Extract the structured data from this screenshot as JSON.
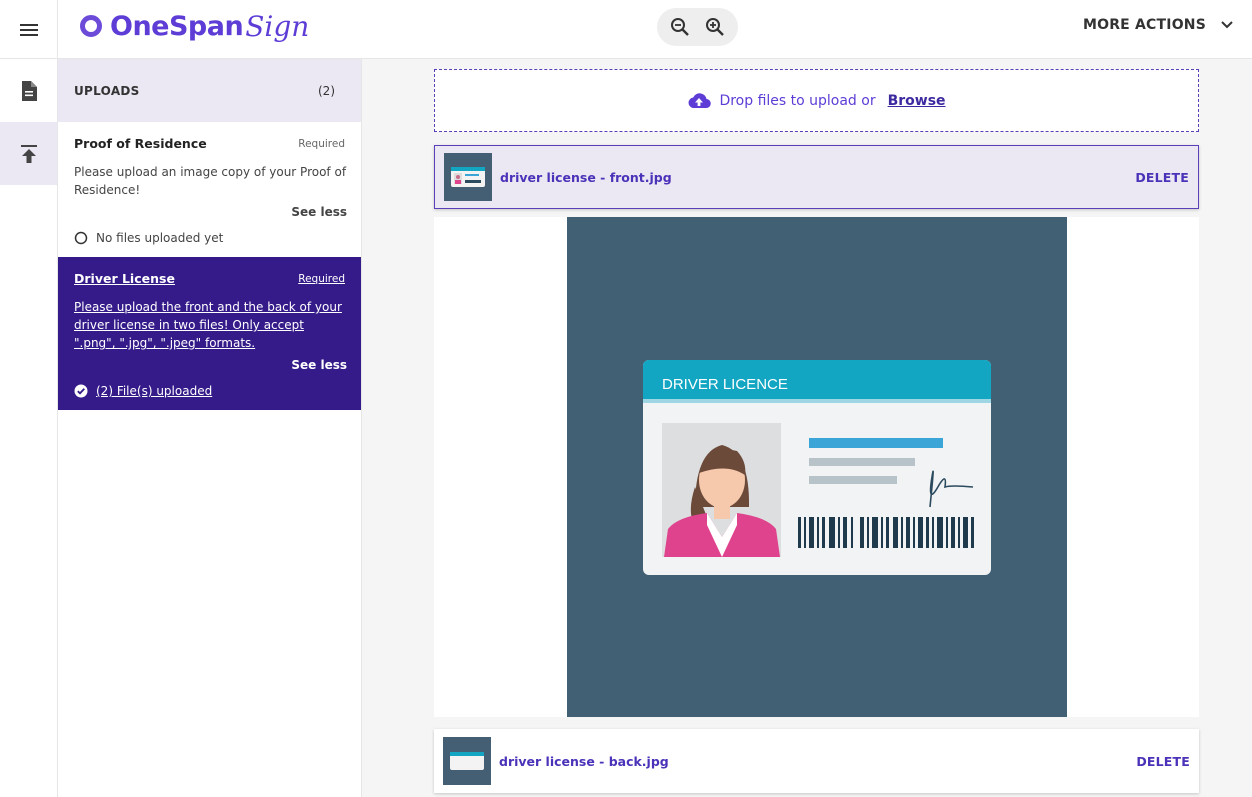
{
  "header": {
    "brand": "OneSpan",
    "brand_script": "Sign",
    "more_actions_label": "MORE ACTIONS"
  },
  "uploads": {
    "title": "UPLOADS",
    "count": "(2)",
    "items": [
      {
        "title": "Proof of Residence",
        "required": "Required",
        "description": "Please upload an image copy of your Proof of Residence!",
        "see_less": "See less",
        "status": "No files uploaded yet"
      },
      {
        "title": "Driver License",
        "required": "Required",
        "description": "Please upload the front and the back of your driver license in two files! Only accept \".png\", \".jpg\", \".jpeg\" formats.",
        "see_less": "See less",
        "status": "(2) File(s) uploaded"
      }
    ]
  },
  "dropzone": {
    "text": "Drop files to upload or",
    "browse": "Browse"
  },
  "files": [
    {
      "name": "driver license - front.jpg",
      "delete": "DELETE"
    },
    {
      "name": "driver license - back.jpg",
      "delete": "DELETE"
    }
  ],
  "preview": {
    "card_title": "DRIVER LICENCE"
  },
  "colors": {
    "accent": "#5d3dd6",
    "selected_bg": "#351b8a",
    "panel_highlight": "#ebe8f3",
    "preview_bg": "#426074",
    "card_header": "#12a6c3"
  },
  "icons": [
    "menu-icon",
    "zoom-out-icon",
    "zoom-in-icon",
    "chevron-down-icon",
    "document-icon",
    "upload-icon",
    "cloud-upload-icon",
    "radio-empty-icon",
    "check-circle-icon"
  ]
}
